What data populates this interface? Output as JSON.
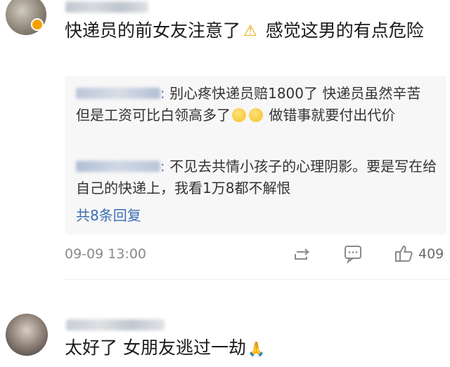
{
  "comments": [
    {
      "text_part1": "快递员的前女友注意了",
      "text_part2": " 感觉这男的有点危险",
      "replies": [
        {
          "name_suffix": ":",
          "text": " 别心疼快递员赔1800了 快递员虽然辛苦 但是工资可比白领高多了",
          "text_after_emoji": " 做错事就要付出代价"
        },
        {
          "name_suffix": ":",
          "text": " 不见去共情小孩子的心理阴影。要是写在给自己的快递上，我看1万8都不解恨"
        }
      ],
      "more_replies": "共8条回复",
      "time": "09-09 13:00",
      "likes": "409"
    },
    {
      "text": "太好了 女朋友逃过一劫"
    }
  ],
  "icons": {
    "warning": "warning-icon",
    "pray": "pray-icon",
    "share": "share-icon",
    "comment": "comment-icon",
    "like": "like-icon"
  }
}
